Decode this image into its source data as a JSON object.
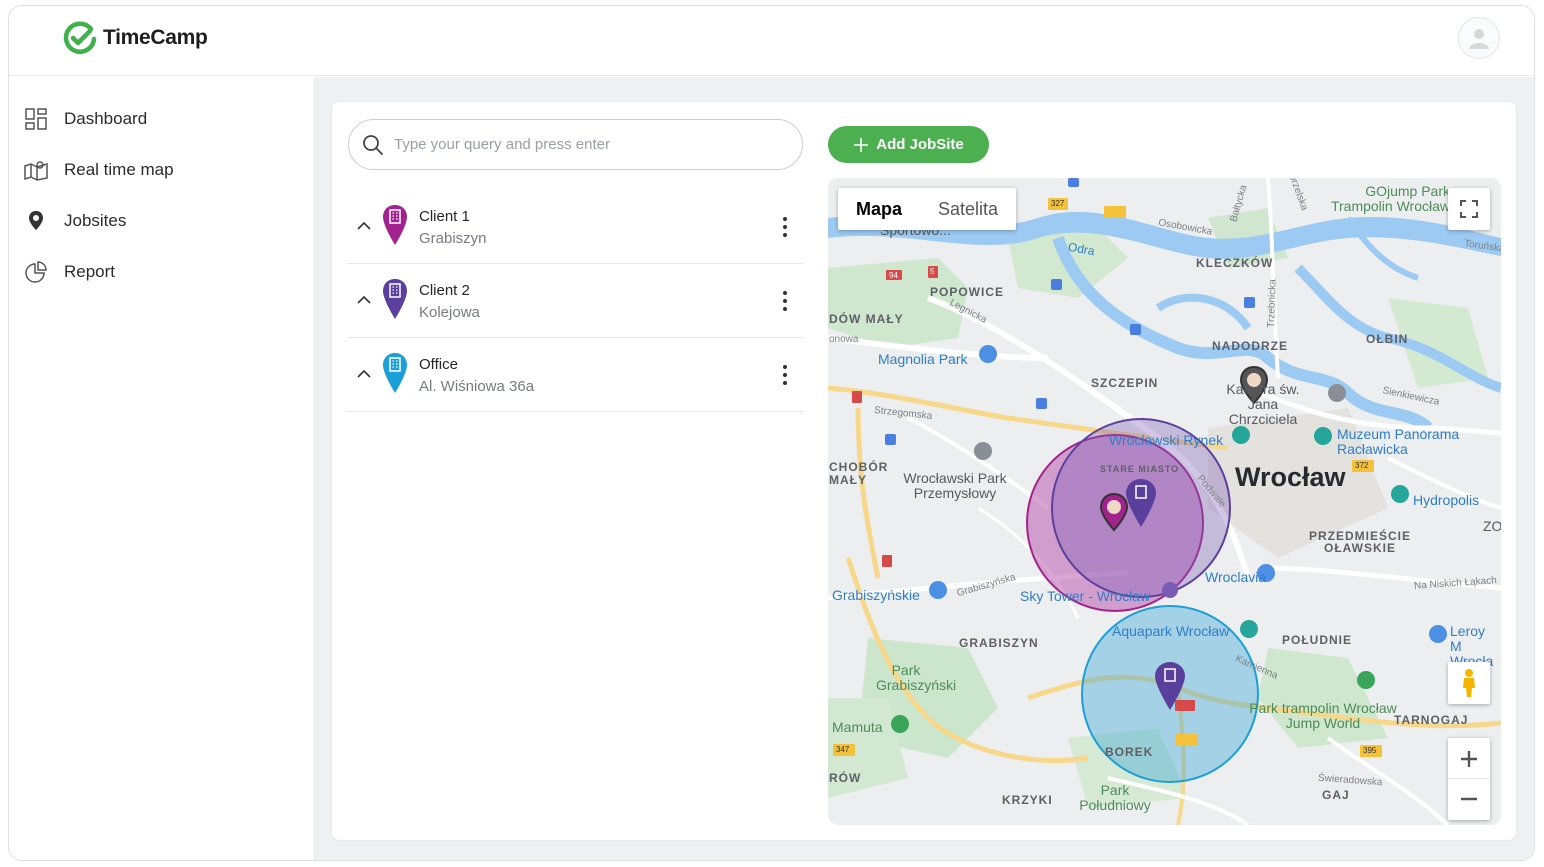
{
  "app": {
    "name": "TimeCamp",
    "brand_color": "#4caf50"
  },
  "sidebar": {
    "items": [
      {
        "label": "Dashboard",
        "icon": "dashboard-grid-icon"
      },
      {
        "label": "Real time map",
        "icon": "map-icon"
      },
      {
        "label": "Jobsites",
        "icon": "location-pin-icon"
      },
      {
        "label": "Report",
        "icon": "pie-chart-icon"
      }
    ]
  },
  "search": {
    "placeholder": "Type your query and press enter",
    "value": ""
  },
  "toolbar": {
    "add_label": "Add JobSite"
  },
  "jobsites": [
    {
      "title": "Client 1",
      "subtitle": "Grabiszyn",
      "color": "#a3238e"
    },
    {
      "title": "Client 2",
      "subtitle": "Kolejowa",
      "color": "#5b3f9c"
    },
    {
      "title": "Office",
      "subtitle": "Al. Wiśniowa 36a",
      "color": "#1c9fd6"
    }
  ],
  "map": {
    "type_tabs": [
      "Mapa",
      "Satelita"
    ],
    "active_tab": "Mapa",
    "city": "Wrocław",
    "districts": [
      "POPOWICE",
      "KLECZKÓW",
      "NADODRZE",
      "OŁBIN",
      "SZCZEPIN",
      "STARE MIASTO",
      "PRZEDMIEŚCIE OŁAWSKIE",
      "GRABISZYN",
      "POŁUDNIE",
      "BOREK",
      "TARNOGAJ",
      "KRZYKI",
      "GAJ",
      "CHOBÓR MAŁY",
      "DÓW MAŁY",
      "RÓW"
    ],
    "pois": [
      "Magnolia Park",
      "Wrocławski Rynek",
      "Muzeum Panorama Racławicka",
      "Hydropolis",
      "Wroclavia",
      "Sky Tower - Wrocław",
      "Aquapark Wrocław",
      "Grabiszyńskie",
      "Leroy M Wrocła",
      "Katedra św. Jana Chrzciciela",
      "Wrocławski Park Przemysłowy",
      "GOjump Park Trampolin Wrocław"
    ],
    "parks": [
      "Park Grabiszyński",
      "Mamuta",
      "Park trampolin Wrocław Jump World",
      "Park Południowy"
    ],
    "roads": [
      "94",
      "5",
      "327",
      "347",
      "372",
      "395"
    ],
    "streets": [
      "Legnicka",
      "Strzegomska",
      "Grabiszyńska",
      "Kamienna",
      "Sienkiewicza",
      "Osobowicka",
      "Bałtycka",
      "Trzebnicka",
      "Na Niskich Łąkach",
      "Świeradowska",
      "Podwale",
      "Toruńska",
      "Odra",
      "Sportowo...",
      "onowa",
      "Zegorzelska",
      "ZO"
    ],
    "zone_colors": {
      "client1": "#b03aa0",
      "client2": "#7a5bb5",
      "office": "#3aa6d8"
    }
  }
}
